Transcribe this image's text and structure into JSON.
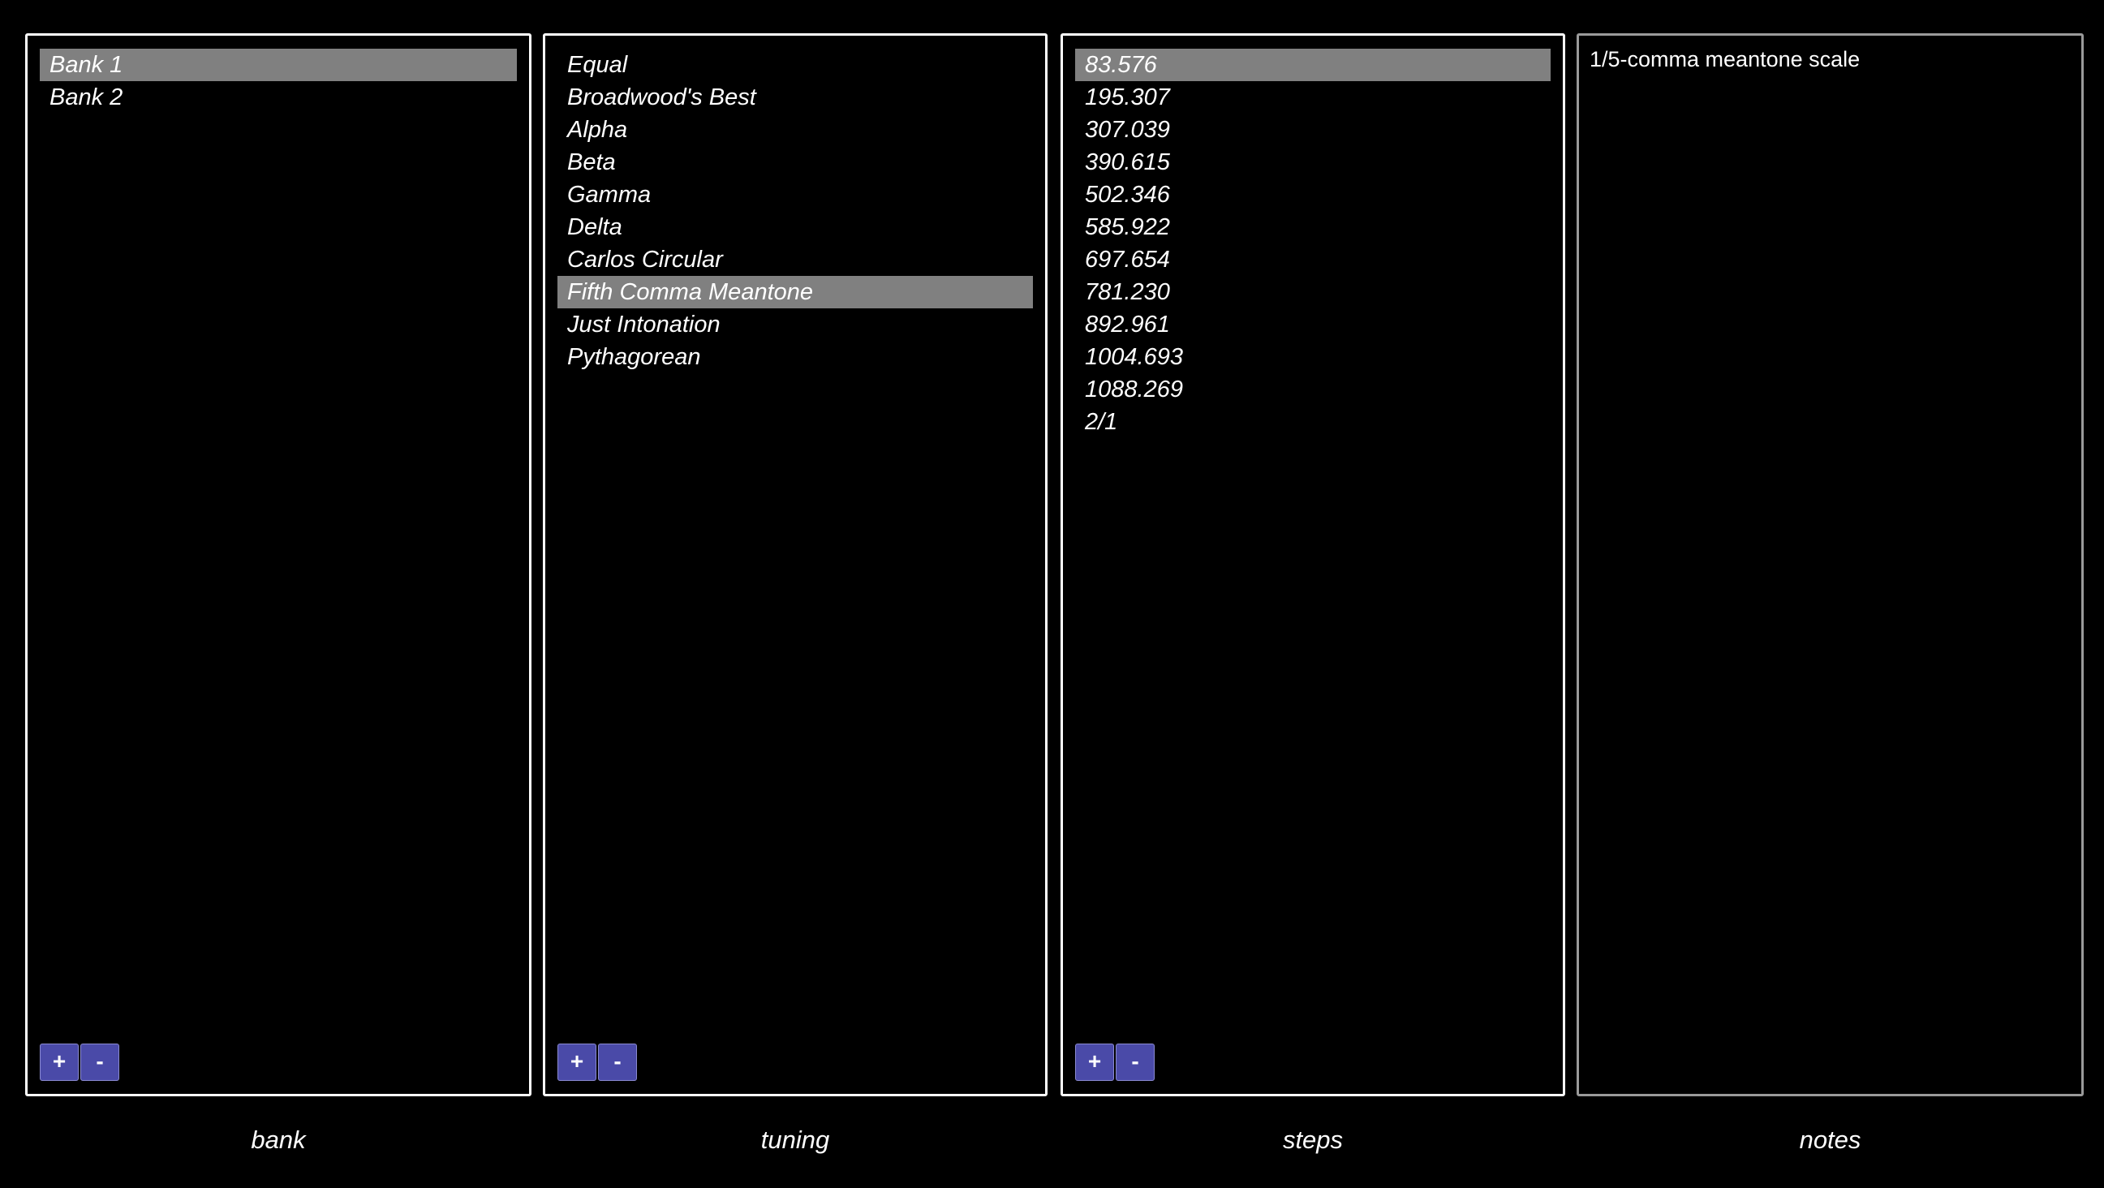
{
  "bank": {
    "caption": "bank",
    "items": [
      "Bank 1",
      "Bank 2"
    ],
    "selected_index": 0,
    "add_label": "+",
    "remove_label": "-"
  },
  "tuning": {
    "caption": "tuning",
    "items": [
      "Equal",
      "Broadwood's Best",
      "Alpha",
      "Beta",
      "Gamma",
      "Delta",
      "Carlos Circular",
      "Fifth Comma Meantone",
      "Just Intonation",
      "Pythagorean"
    ],
    "selected_index": 7,
    "add_label": "+",
    "remove_label": "-"
  },
  "steps": {
    "caption": "steps",
    "items": [
      "83.576",
      "195.307",
      "307.039",
      "390.615",
      "502.346",
      "585.922",
      "697.654",
      "781.230",
      "892.961",
      "1004.693",
      "1088.269",
      "2/1"
    ],
    "selected_index": 0,
    "add_label": "+",
    "remove_label": "-"
  },
  "notes": {
    "caption": "notes",
    "text": "1/5-comma meantone scale"
  },
  "colors": {
    "background": "#000000",
    "selection": "#808080",
    "button": "#4a4aa8",
    "border": "#ffffff",
    "notes_border": "#9a9a9a"
  }
}
